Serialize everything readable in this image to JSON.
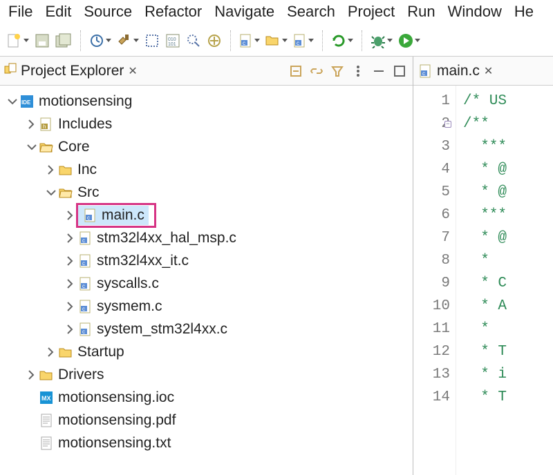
{
  "menu": [
    "File",
    "Edit",
    "Source",
    "Refactor",
    "Navigate",
    "Search",
    "Project",
    "Run",
    "Window",
    "He"
  ],
  "explorer": {
    "title": "Project Explorer",
    "project": "motionsensing",
    "includes": "Includes",
    "core": "Core",
    "inc": "Inc",
    "src": "Src",
    "src_files": [
      "main.c",
      "stm32l4xx_hal_msp.c",
      "stm32l4xx_it.c",
      "syscalls.c",
      "sysmem.c",
      "system_stm32l4xx.c"
    ],
    "startup": "Startup",
    "drivers": "Drivers",
    "root_files": [
      "motionsensing.ioc",
      "motionsensing.pdf",
      "motionsensing.txt"
    ]
  },
  "editor": {
    "tab": "main.c",
    "lines": [
      "/* US",
      "/**",
      "  ***",
      "  * @",
      "  * @",
      "  ***",
      "  * @",
      "  *",
      "  * C",
      "  * A",
      "  *",
      "  * T",
      "  * i",
      "  * T"
    ]
  }
}
